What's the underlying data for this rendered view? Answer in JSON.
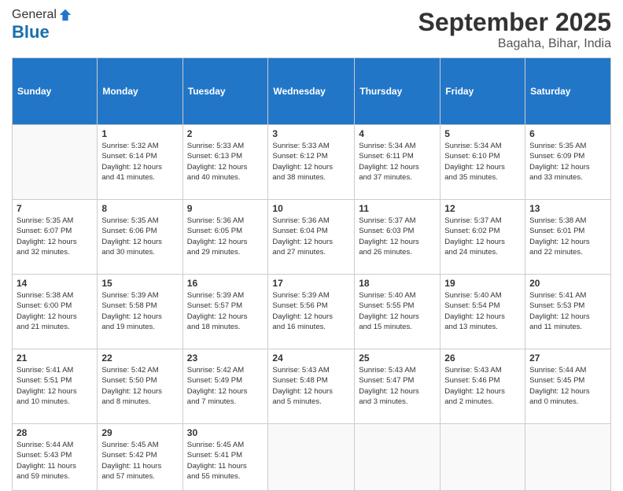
{
  "header": {
    "logo_line1": "General",
    "logo_line2": "Blue",
    "month": "September 2025",
    "location": "Bagaha, Bihar, India"
  },
  "days_of_week": [
    "Sunday",
    "Monday",
    "Tuesday",
    "Wednesday",
    "Thursday",
    "Friday",
    "Saturday"
  ],
  "weeks": [
    [
      {
        "day": "",
        "info": ""
      },
      {
        "day": "1",
        "info": "Sunrise: 5:32 AM\nSunset: 6:14 PM\nDaylight: 12 hours\nand 41 minutes."
      },
      {
        "day": "2",
        "info": "Sunrise: 5:33 AM\nSunset: 6:13 PM\nDaylight: 12 hours\nand 40 minutes."
      },
      {
        "day": "3",
        "info": "Sunrise: 5:33 AM\nSunset: 6:12 PM\nDaylight: 12 hours\nand 38 minutes."
      },
      {
        "day": "4",
        "info": "Sunrise: 5:34 AM\nSunset: 6:11 PM\nDaylight: 12 hours\nand 37 minutes."
      },
      {
        "day": "5",
        "info": "Sunrise: 5:34 AM\nSunset: 6:10 PM\nDaylight: 12 hours\nand 35 minutes."
      },
      {
        "day": "6",
        "info": "Sunrise: 5:35 AM\nSunset: 6:09 PM\nDaylight: 12 hours\nand 33 minutes."
      }
    ],
    [
      {
        "day": "7",
        "info": "Sunrise: 5:35 AM\nSunset: 6:07 PM\nDaylight: 12 hours\nand 32 minutes."
      },
      {
        "day": "8",
        "info": "Sunrise: 5:35 AM\nSunset: 6:06 PM\nDaylight: 12 hours\nand 30 minutes."
      },
      {
        "day": "9",
        "info": "Sunrise: 5:36 AM\nSunset: 6:05 PM\nDaylight: 12 hours\nand 29 minutes."
      },
      {
        "day": "10",
        "info": "Sunrise: 5:36 AM\nSunset: 6:04 PM\nDaylight: 12 hours\nand 27 minutes."
      },
      {
        "day": "11",
        "info": "Sunrise: 5:37 AM\nSunset: 6:03 PM\nDaylight: 12 hours\nand 26 minutes."
      },
      {
        "day": "12",
        "info": "Sunrise: 5:37 AM\nSunset: 6:02 PM\nDaylight: 12 hours\nand 24 minutes."
      },
      {
        "day": "13",
        "info": "Sunrise: 5:38 AM\nSunset: 6:01 PM\nDaylight: 12 hours\nand 22 minutes."
      }
    ],
    [
      {
        "day": "14",
        "info": "Sunrise: 5:38 AM\nSunset: 6:00 PM\nDaylight: 12 hours\nand 21 minutes."
      },
      {
        "day": "15",
        "info": "Sunrise: 5:39 AM\nSunset: 5:58 PM\nDaylight: 12 hours\nand 19 minutes."
      },
      {
        "day": "16",
        "info": "Sunrise: 5:39 AM\nSunset: 5:57 PM\nDaylight: 12 hours\nand 18 minutes."
      },
      {
        "day": "17",
        "info": "Sunrise: 5:39 AM\nSunset: 5:56 PM\nDaylight: 12 hours\nand 16 minutes."
      },
      {
        "day": "18",
        "info": "Sunrise: 5:40 AM\nSunset: 5:55 PM\nDaylight: 12 hours\nand 15 minutes."
      },
      {
        "day": "19",
        "info": "Sunrise: 5:40 AM\nSunset: 5:54 PM\nDaylight: 12 hours\nand 13 minutes."
      },
      {
        "day": "20",
        "info": "Sunrise: 5:41 AM\nSunset: 5:53 PM\nDaylight: 12 hours\nand 11 minutes."
      }
    ],
    [
      {
        "day": "21",
        "info": "Sunrise: 5:41 AM\nSunset: 5:51 PM\nDaylight: 12 hours\nand 10 minutes."
      },
      {
        "day": "22",
        "info": "Sunrise: 5:42 AM\nSunset: 5:50 PM\nDaylight: 12 hours\nand 8 minutes."
      },
      {
        "day": "23",
        "info": "Sunrise: 5:42 AM\nSunset: 5:49 PM\nDaylight: 12 hours\nand 7 minutes."
      },
      {
        "day": "24",
        "info": "Sunrise: 5:43 AM\nSunset: 5:48 PM\nDaylight: 12 hours\nand 5 minutes."
      },
      {
        "day": "25",
        "info": "Sunrise: 5:43 AM\nSunset: 5:47 PM\nDaylight: 12 hours\nand 3 minutes."
      },
      {
        "day": "26",
        "info": "Sunrise: 5:43 AM\nSunset: 5:46 PM\nDaylight: 12 hours\nand 2 minutes."
      },
      {
        "day": "27",
        "info": "Sunrise: 5:44 AM\nSunset: 5:45 PM\nDaylight: 12 hours\nand 0 minutes."
      }
    ],
    [
      {
        "day": "28",
        "info": "Sunrise: 5:44 AM\nSunset: 5:43 PM\nDaylight: 11 hours\nand 59 minutes."
      },
      {
        "day": "29",
        "info": "Sunrise: 5:45 AM\nSunset: 5:42 PM\nDaylight: 11 hours\nand 57 minutes."
      },
      {
        "day": "30",
        "info": "Sunrise: 5:45 AM\nSunset: 5:41 PM\nDaylight: 11 hours\nand 55 minutes."
      },
      {
        "day": "",
        "info": ""
      },
      {
        "day": "",
        "info": ""
      },
      {
        "day": "",
        "info": ""
      },
      {
        "day": "",
        "info": ""
      }
    ]
  ]
}
